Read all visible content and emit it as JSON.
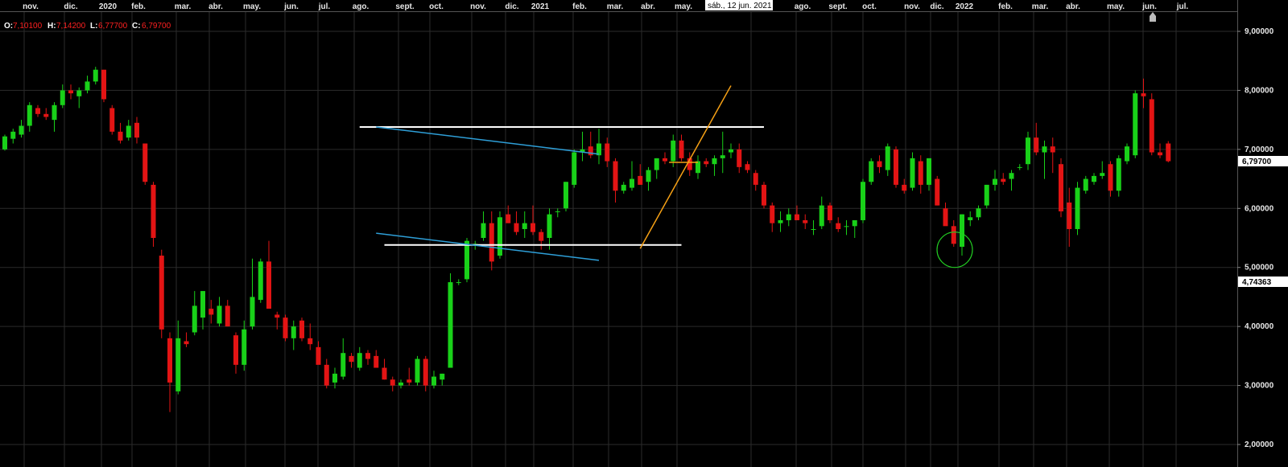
{
  "ohlc": {
    "o_label": "O:",
    "o_value": "7,10100",
    "h_label": "H:",
    "h_value": "7,14200",
    "l_label": "L:",
    "l_value": "6,77700",
    "c_label": "C:",
    "c_value": "6,79700"
  },
  "date_cursor": "sáb., 12 jun. 2021",
  "last_price_tag": "6,79700",
  "marker_price_tag": "4,74363",
  "colors": {
    "background": "#000000",
    "grid": "#2b2b2b",
    "up": "#19d119",
    "down": "#e31414",
    "trendline_white": "#ffffff",
    "trendline_blue": "#2e9fd8",
    "trendline_orange": "#f5a015",
    "circle": "#22cc22"
  },
  "chart_data": {
    "type": "candlestick",
    "interval": "weekly",
    "x_axis_labels": [
      "nov.",
      "dic.",
      "2020",
      "feb.",
      "mar.",
      "abr.",
      "may.",
      "jun.",
      "jul.",
      "ago.",
      "sept.",
      "oct.",
      "nov.",
      "dic.",
      "2021",
      "feb.",
      "mar.",
      "abr.",
      "may.",
      "jul.",
      "ago.",
      "sept.",
      "oct.",
      "nov.",
      "dic.",
      "2022",
      "feb.",
      "mar.",
      "abr.",
      "may.",
      "jun.",
      "jul."
    ],
    "y_axis": {
      "ticks": [
        "9,00000",
        "8,00000",
        "7,00000",
        "6,00000",
        "5,00000",
        "4,00000",
        "3,00000",
        "2,00000"
      ],
      "tick_values": [
        9,
        8,
        7,
        6,
        5,
        4,
        3,
        2
      ],
      "range": [
        1.6,
        9.3
      ]
    },
    "candles": [
      [
        7.0,
        7.25,
        6.98,
        7.22
      ],
      [
        7.18,
        7.35,
        7.1,
        7.3
      ],
      [
        7.25,
        7.5,
        7.2,
        7.4
      ],
      [
        7.4,
        7.8,
        7.3,
        7.75
      ],
      [
        7.7,
        7.75,
        7.55,
        7.6
      ],
      [
        7.6,
        7.7,
        7.5,
        7.55
      ],
      [
        7.5,
        7.8,
        7.3,
        7.75
      ],
      [
        7.75,
        8.1,
        7.7,
        8.0
      ],
      [
        8.0,
        8.1,
        7.85,
        7.95
      ],
      [
        7.9,
        8.05,
        7.7,
        8.0
      ],
      [
        8.0,
        8.25,
        7.95,
        8.15
      ],
      [
        8.15,
        8.4,
        8.1,
        8.35
      ],
      [
        8.35,
        8.35,
        7.8,
        7.85
      ],
      [
        7.7,
        7.75,
        7.25,
        7.3
      ],
      [
        7.3,
        7.45,
        7.1,
        7.15
      ],
      [
        7.2,
        7.5,
        7.15,
        7.4
      ],
      [
        7.45,
        7.55,
        7.1,
        7.2
      ],
      [
        7.1,
        7.1,
        6.4,
        6.45
      ],
      [
        6.4,
        6.45,
        5.35,
        5.5
      ],
      [
        5.2,
        5.3,
        3.8,
        3.95
      ],
      [
        3.8,
        3.9,
        2.55,
        3.05
      ],
      [
        2.9,
        4.1,
        2.85,
        3.8
      ],
      [
        3.75,
        3.9,
        3.65,
        3.7
      ],
      [
        3.9,
        4.6,
        3.85,
        4.35
      ],
      [
        4.15,
        4.6,
        3.95,
        4.6
      ],
      [
        4.3,
        4.45,
        4.05,
        4.2
      ],
      [
        4.05,
        4.5,
        4.0,
        4.35
      ],
      [
        4.35,
        4.45,
        4.0,
        4.0
      ],
      [
        3.85,
        3.9,
        3.2,
        3.35
      ],
      [
        3.35,
        4.1,
        3.25,
        3.95
      ],
      [
        4.0,
        5.15,
        3.95,
        4.5
      ],
      [
        4.45,
        5.15,
        4.4,
        5.1
      ],
      [
        5.1,
        5.45,
        4.95,
        4.3
      ],
      [
        4.2,
        4.25,
        3.95,
        4.15
      ],
      [
        4.15,
        4.2,
        3.75,
        3.8
      ],
      [
        3.8,
        4.1,
        3.6,
        4.0
      ],
      [
        4.1,
        4.15,
        3.75,
        3.8
      ],
      [
        3.8,
        4.05,
        3.6,
        3.7
      ],
      [
        3.65,
        3.75,
        3.4,
        3.35
      ],
      [
        3.35,
        3.45,
        2.95,
        3.0
      ],
      [
        3.05,
        3.3,
        2.95,
        3.2
      ],
      [
        3.15,
        3.8,
        3.1,
        3.55
      ],
      [
        3.5,
        3.55,
        3.3,
        3.4
      ],
      [
        3.3,
        3.65,
        3.25,
        3.55
      ],
      [
        3.55,
        3.6,
        3.35,
        3.45
      ],
      [
        3.5,
        3.6,
        3.3,
        3.3
      ],
      [
        3.3,
        3.45,
        3.1,
        3.1
      ],
      [
        3.1,
        3.15,
        2.9,
        3.0
      ],
      [
        3.0,
        3.1,
        2.95,
        3.05
      ],
      [
        3.1,
        3.3,
        3.0,
        3.05
      ],
      [
        3.05,
        3.5,
        3.0,
        3.45
      ],
      [
        3.45,
        3.5,
        2.9,
        3.0
      ],
      [
        3.0,
        3.25,
        2.95,
        3.15
      ],
      [
        3.1,
        3.2,
        3.0,
        3.2
      ],
      [
        3.3,
        4.9,
        3.3,
        4.75
      ],
      [
        4.75,
        4.8,
        4.7,
        4.75
      ],
      [
        4.8,
        5.5,
        4.75,
        5.45
      ],
      [
        5.4,
        5.45,
        5.3,
        5.4
      ],
      [
        5.5,
        5.95,
        5.45,
        5.75
      ],
      [
        5.75,
        5.95,
        4.95,
        5.1
      ],
      [
        5.2,
        5.95,
        5.15,
        5.85
      ],
      [
        5.9,
        6.05,
        5.75,
        5.75
      ],
      [
        5.75,
        5.95,
        5.55,
        5.6
      ],
      [
        5.65,
        5.95,
        5.5,
        5.75
      ],
      [
        5.75,
        6.05,
        5.55,
        5.6
      ],
      [
        5.6,
        5.65,
        5.3,
        5.45
      ],
      [
        5.5,
        6.0,
        5.3,
        5.9
      ],
      [
        5.95,
        6.0,
        5.85,
        5.95
      ],
      [
        6.0,
        6.45,
        5.95,
        6.45
      ],
      [
        6.4,
        7.0,
        6.35,
        6.95
      ],
      [
        6.95,
        7.3,
        6.8,
        7.0
      ],
      [
        7.05,
        7.3,
        6.85,
        6.9
      ],
      [
        6.9,
        7.35,
        6.75,
        7.1
      ],
      [
        7.1,
        7.2,
        6.7,
        6.8
      ],
      [
        6.8,
        6.85,
        6.1,
        6.3
      ],
      [
        6.3,
        6.45,
        6.25,
        6.4
      ],
      [
        6.35,
        6.8,
        6.3,
        6.5
      ],
      [
        6.55,
        6.75,
        6.45,
        6.4
      ],
      [
        6.45,
        6.7,
        6.3,
        6.65
      ],
      [
        6.65,
        6.85,
        6.5,
        6.85
      ],
      [
        6.85,
        6.95,
        6.75,
        6.8
      ],
      [
        6.8,
        7.25,
        6.7,
        7.15
      ],
      [
        7.15,
        7.25,
        6.8,
        6.85
      ],
      [
        6.85,
        6.95,
        6.55,
        6.65
      ],
      [
        6.6,
        6.9,
        6.5,
        6.8
      ],
      [
        6.8,
        6.85,
        6.7,
        6.75
      ],
      [
        6.75,
        6.9,
        6.55,
        6.85
      ],
      [
        6.85,
        7.3,
        6.6,
        6.9
      ],
      [
        6.95,
        7.1,
        6.85,
        7.0
      ],
      [
        7.0,
        7.1,
        6.6,
        6.7
      ],
      [
        6.75,
        6.8,
        6.6,
        6.65
      ],
      [
        6.6,
        6.65,
        6.3,
        6.4
      ],
      [
        6.4,
        6.45,
        6.0,
        6.05
      ],
      [
        6.05,
        6.1,
        5.6,
        5.75
      ],
      [
        5.75,
        5.95,
        5.6,
        5.8
      ],
      [
        5.8,
        6.0,
        5.7,
        5.9
      ],
      [
        5.9,
        6.05,
        5.8,
        5.8
      ],
      [
        5.8,
        5.9,
        5.65,
        5.75
      ],
      [
        5.65,
        5.8,
        5.55,
        5.65
      ],
      [
        5.7,
        6.2,
        5.65,
        6.05
      ],
      [
        6.05,
        6.1,
        5.75,
        5.8
      ],
      [
        5.75,
        5.85,
        5.6,
        5.65
      ],
      [
        5.7,
        5.8,
        5.55,
        5.7
      ],
      [
        5.7,
        5.8,
        5.5,
        5.8
      ],
      [
        5.8,
        6.5,
        5.75,
        6.45
      ],
      [
        6.45,
        6.85,
        6.4,
        6.8
      ],
      [
        6.8,
        6.9,
        6.6,
        6.7
      ],
      [
        6.65,
        7.1,
        6.55,
        7.05
      ],
      [
        7.0,
        7.05,
        6.35,
        6.4
      ],
      [
        6.4,
        6.5,
        6.25,
        6.3
      ],
      [
        6.35,
        6.95,
        6.3,
        6.85
      ],
      [
        6.8,
        6.9,
        6.25,
        6.4
      ],
      [
        6.4,
        6.85,
        6.3,
        6.85
      ],
      [
        6.5,
        6.55,
        6.05,
        6.05
      ],
      [
        6.0,
        6.1,
        5.8,
        5.7
      ],
      [
        5.7,
        5.8,
        5.35,
        5.4
      ],
      [
        5.35,
        5.9,
        5.2,
        5.9
      ],
      [
        5.8,
        5.95,
        5.7,
        5.85
      ],
      [
        5.85,
        6.05,
        5.8,
        6.0
      ],
      [
        6.05,
        6.4,
        6.0,
        6.4
      ],
      [
        6.4,
        6.65,
        6.3,
        6.5
      ],
      [
        6.5,
        6.6,
        6.4,
        6.45
      ],
      [
        6.5,
        6.65,
        6.3,
        6.6
      ],
      [
        6.7,
        6.75,
        6.65,
        6.7
      ],
      [
        6.75,
        7.3,
        6.65,
        7.2
      ],
      [
        7.2,
        7.45,
        6.9,
        6.95
      ],
      [
        6.95,
        7.15,
        6.5,
        7.05
      ],
      [
        7.05,
        7.2,
        6.6,
        6.95
      ],
      [
        6.75,
        6.85,
        5.85,
        5.95
      ],
      [
        6.1,
        6.35,
        5.35,
        5.65
      ],
      [
        5.65,
        6.45,
        5.55,
        6.35
      ],
      [
        6.3,
        6.55,
        6.25,
        6.5
      ],
      [
        6.45,
        6.6,
        6.4,
        6.55
      ],
      [
        6.55,
        6.8,
        6.5,
        6.6
      ],
      [
        6.75,
        6.8,
        6.2,
        6.3
      ],
      [
        6.3,
        6.9,
        6.2,
        6.85
      ],
      [
        6.8,
        7.1,
        6.75,
        7.05
      ],
      [
        6.9,
        8.0,
        6.85,
        7.95
      ],
      [
        7.95,
        8.2,
        7.7,
        7.9
      ],
      [
        7.85,
        7.95,
        6.9,
        6.95
      ],
      [
        6.95,
        7.1,
        6.85,
        6.9
      ],
      [
        7.1,
        7.14,
        6.78,
        6.8
      ]
    ],
    "trendlines": [
      {
        "color": "white",
        "points": [
          [
            43,
            7.38
          ],
          [
            92,
            7.38
          ]
        ]
      },
      {
        "color": "white",
        "points": [
          [
            46,
            5.38
          ],
          [
            82,
            5.38
          ]
        ]
      },
      {
        "color": "blue",
        "points": [
          [
            45,
            7.38
          ],
          [
            72,
            6.92
          ]
        ]
      },
      {
        "color": "blue",
        "points": [
          [
            45,
            5.58
          ],
          [
            72,
            5.12
          ]
        ]
      },
      {
        "color": "orange",
        "points": [
          [
            77,
            5.32
          ],
          [
            88,
            8.08
          ]
        ]
      },
      {
        "color": "orange",
        "points": [
          [
            80.5,
            6.78
          ],
          [
            84,
            6.78
          ]
        ]
      }
    ]
  }
}
